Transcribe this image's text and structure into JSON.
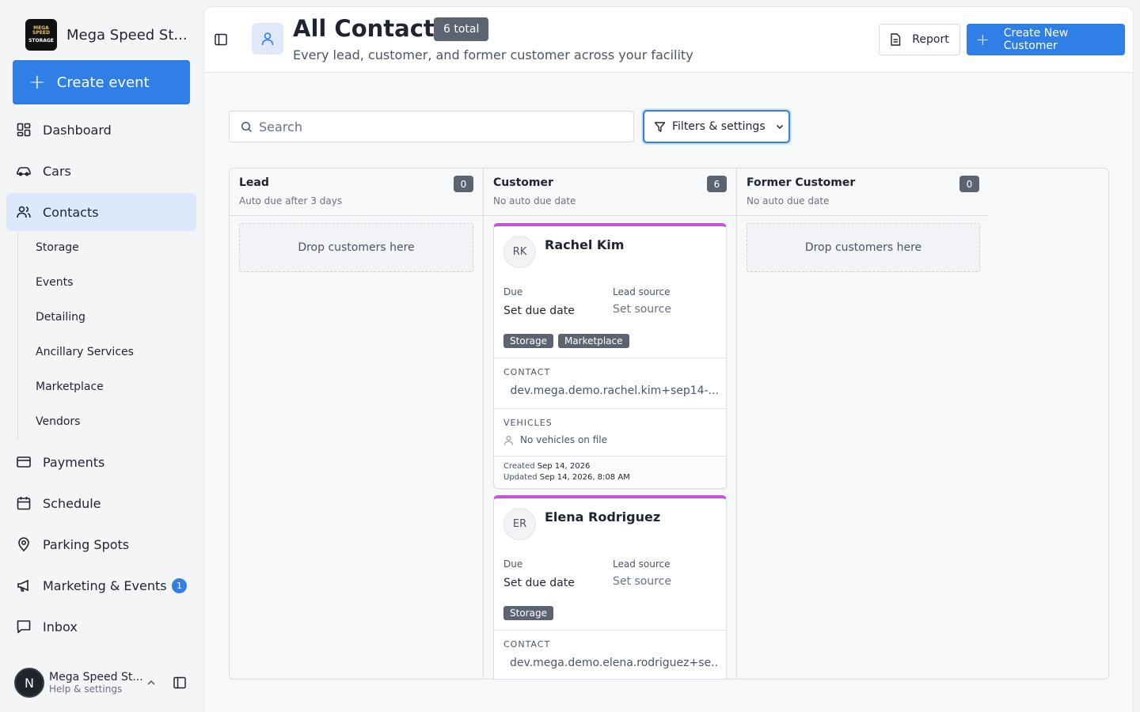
{
  "brand": {
    "name": "Mega Speed St...",
    "logo_line1": "MEGA SPEED",
    "logo_line2": "STORAGE"
  },
  "sidebar": {
    "create_label": "Create event",
    "items": [
      {
        "label": "Dashboard",
        "icon": "grid-icon"
      },
      {
        "label": "Cars",
        "icon": "car-icon"
      },
      {
        "label": "Contacts",
        "icon": "users-icon"
      },
      {
        "label": "Payments",
        "icon": "card-icon"
      },
      {
        "label": "Schedule",
        "icon": "calendar-icon"
      },
      {
        "label": "Parking Spots",
        "icon": "pin-icon"
      },
      {
        "label": "Marketing & Events",
        "icon": "megaphone-icon",
        "badge": "1"
      },
      {
        "label": "Inbox",
        "icon": "chat-icon"
      }
    ],
    "subitems": [
      "Storage",
      "Events",
      "Detailing",
      "Ancillary Services",
      "Marketplace",
      "Vendors"
    ]
  },
  "profile": {
    "initial": "N",
    "name": "Mega Speed St...",
    "sub": "Help & settings"
  },
  "header": {
    "title": "All Contacts",
    "total_badge": "6 total",
    "subtitle": "Every lead, customer, and former customer across your facility",
    "report_label": "Report",
    "new_label": "Create New Customer"
  },
  "toolbar": {
    "search_placeholder": "Search",
    "filter_label": "Filters & settings"
  },
  "columns": [
    {
      "title": "Lead",
      "sub": "Auto due after 3 days",
      "count": "0",
      "drop": "Drop customers here"
    },
    {
      "title": "Customer",
      "sub": "No auto due date",
      "count": "6"
    },
    {
      "title": "Former Customer",
      "sub": "No auto due date",
      "count": "0",
      "drop": "Drop customers here"
    }
  ],
  "cards": [
    {
      "initials": "RK",
      "name": "Rachel Kim",
      "due_label": "Due",
      "due_value": "Set due date",
      "source_label": "Lead source",
      "source_value": "Set source",
      "tags": [
        "Storage",
        "Marketplace"
      ],
      "contact_label": "CONTACT",
      "email": "dev.mega.demo.rachel.kim+sep14-...",
      "vehicles_label": "VEHICLES",
      "vehicles": "No vehicles on file",
      "created_label": "Created",
      "created": "Sep 14, 2026",
      "updated_label": "Updated",
      "updated": "Sep 14, 2026, 8:08 AM"
    },
    {
      "initials": "ER",
      "name": "Elena Rodriguez",
      "due_label": "Due",
      "due_value": "Set due date",
      "source_label": "Lead source",
      "source_value": "Set source",
      "tags": [
        "Storage"
      ],
      "contact_label": "CONTACT",
      "email": "dev.mega.demo.elena.rodriguez+se..."
    }
  ],
  "colors": {
    "accent": "#2f7fe6",
    "active_nav": "#dde8fb",
    "card_top": "#c853d8",
    "badge": "#5b6470"
  }
}
